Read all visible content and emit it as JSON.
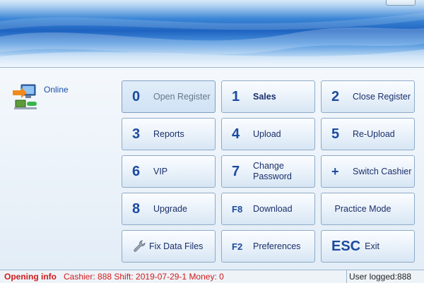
{
  "status": {
    "label": "Online"
  },
  "buttons": [
    {
      "key": "0",
      "label": "Open Register"
    },
    {
      "key": "1",
      "label": "Sales"
    },
    {
      "key": "2",
      "label": "Close Register"
    },
    {
      "key": "3",
      "label": "Reports"
    },
    {
      "key": "4",
      "label": "Upload"
    },
    {
      "key": "5",
      "label": "Re-Upload"
    },
    {
      "key": "6",
      "label": "VIP"
    },
    {
      "key": "7",
      "label_line1": "Change",
      "label_line2": "Password"
    },
    {
      "key": "+",
      "label": "Switch Cashier"
    },
    {
      "key": "8",
      "label": "Upgrade"
    },
    {
      "key": "F8",
      "label": "Download"
    },
    {
      "label": "Practice Mode"
    },
    {
      "icon": "wrench-icon",
      "label": "Fix Data Files"
    },
    {
      "key": "F2",
      "label": "Preferences"
    },
    {
      "key": "ESC",
      "label": "Exit"
    }
  ],
  "statusbar": {
    "title": "Opening info",
    "info": "Cashier: 888 Shift: 2019-07-29-1 Money: 0",
    "user": "User logged:888"
  },
  "colors": {
    "accent": "#1c4a9e",
    "alert": "#d21a1a",
    "banner": "#1e63c0"
  }
}
